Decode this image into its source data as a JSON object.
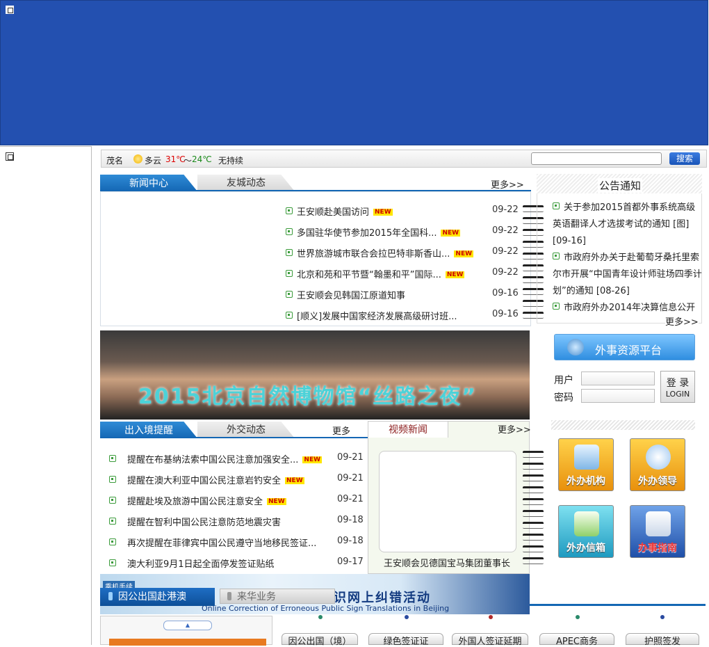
{
  "weather": {
    "city": "茂名",
    "condition": "多云",
    "temp_high": "31℃",
    "separator": "～",
    "temp_low": "24℃",
    "wind": "无持续"
  },
  "search": {
    "button": "搜索",
    "placeholder": ""
  },
  "news_tabs": {
    "active": "新闻中心",
    "inactive": "友城动态",
    "more": "更多>>"
  },
  "news_items": [
    {
      "title": "王安顺赴美国访问",
      "new": true,
      "date": "09-22"
    },
    {
      "title": "多国驻华使节参加2015年全国科...",
      "new": true,
      "date": "09-22"
    },
    {
      "title": "世界旅游城市联合会拉巴特非斯香山...",
      "new": true,
      "date": "09-22"
    },
    {
      "title": "北京和苑和平节暨“翰墨和平”国际...",
      "new": true,
      "date": "09-22"
    },
    {
      "title": "王安顺会见韩国江原道知事",
      "new": false,
      "date": "09-16"
    },
    {
      "title": "[顺义]发展中国家经济发展高级研讨班...",
      "new": false,
      "date": "09-16"
    }
  ],
  "new_badge": "NEW",
  "photo_caption": "2015北京自然博物馆“丝路之夜”",
  "notice": {
    "title": "公告通知",
    "items": [
      "关于参加2015首都外事系统高级英语翻译人才选拔考试的通知 [图][09-16]",
      "市政府外办关于赴葡萄牙桑托里索尔市开展“中国青年设计师驻场四季计划”的通知 [08-26]",
      "市政府外办2014年决算信息公开"
    ],
    "more": "更多>>"
  },
  "resource_platform": "外事资源平台",
  "login": {
    "user_label": "用户",
    "password_label": "密码",
    "button_top": "登 录",
    "button_bottom": "LOGIN"
  },
  "tiles": [
    {
      "label": "外办机构",
      "color": "#f0a020"
    },
    {
      "label": "外办领导",
      "color": "#f0a020"
    },
    {
      "label": "外办信箱",
      "color": "#25a8c8"
    },
    {
      "label": "办事指南",
      "color": "#2a63b8"
    }
  ],
  "entry_tabs": {
    "active": "出入境提醒",
    "inactive": "外交动态",
    "more": "更多"
  },
  "entry_items": [
    {
      "title": "提醒在布基纳法索中国公民注意加强安全...",
      "new": true,
      "date": "09-21"
    },
    {
      "title": "提醒在澳大利亚中国公民注意岩钓安全",
      "new": true,
      "date": "09-21"
    },
    {
      "title": "提醒赴埃及旅游中国公民注意安全",
      "new": true,
      "date": "09-21"
    },
    {
      "title": "提醒在智利中国公民注意防范地震灾害",
      "new": false,
      "date": "09-18"
    },
    {
      "title": "再次提醒在菲律宾中国公民遵守当地移民签证...",
      "new": false,
      "date": "09-18"
    },
    {
      "title": "澳大利亚9月1日起全面停发签证贴纸",
      "new": false,
      "date": "09-17"
    }
  ],
  "video": {
    "tab": "视频新闻",
    "more": "更多>>",
    "caption": "王安顺会见德国宝马集团董事长"
  },
  "bottom_strip": {
    "text": "识网上纠错活动",
    "sub": "Online Correction of Erroneous Public Sign Translations in Beijing",
    "label_small": "乘机手续"
  },
  "bottom_tabs": {
    "active": "因公出国赴港澳",
    "inactive": "来华业务"
  },
  "cards": [
    "因公出国（境）",
    "绿色签证证",
    "外国人签证延期",
    "APEC商务",
    "护照签发"
  ]
}
